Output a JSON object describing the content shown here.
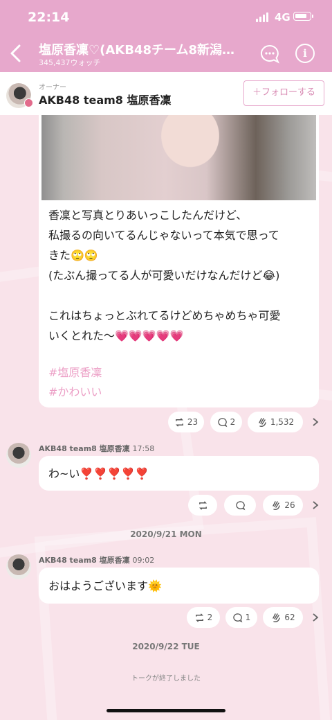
{
  "status_bar": {
    "time": "22:14",
    "network": "4G"
  },
  "header": {
    "title": "塩原香凜♡(AKB48チーム8新潟…",
    "watch_count": "345,437ウォッチ"
  },
  "owner": {
    "label": "オーナー",
    "name": "AKB48 team8 塩原香凜",
    "follow_button": "＋フォローする"
  },
  "post": {
    "line1": "香凜と写真とりあいっこしたんだけど、",
    "line2": "私撮るの向いてるんじゃないって本気で思って",
    "line3": "きた🙄🙄",
    "line4": "(たぶん撮ってる人が可愛いだけなんだけど😂)",
    "line5": "これはちょっとぶれてるけどめちゃめちゃ可愛",
    "line6": "いくとれた〜💗💗💗💗💗",
    "hashtag1": "#塩原香凜",
    "hashtag2": "#かわいい",
    "reactions": {
      "retweet": "23",
      "comment": "2",
      "clap": "1,532"
    }
  },
  "msg2": {
    "sender": "AKB48 team8 塩原香凜",
    "time": "17:58",
    "text": "わ~い❣️❣️❣️❣️❣️",
    "reactions": {
      "clap": "26"
    }
  },
  "date1": "2020/9/21 MON",
  "msg3": {
    "sender": "AKB48 team8 塩原香凜",
    "time": "09:02",
    "text": "おはようございます🌞",
    "reactions": {
      "retweet": "2",
      "comment": "1",
      "clap": "62"
    }
  },
  "date2": "2020/9/22 TUE",
  "end_note": "トークが終了しました",
  "colors": {
    "header_pink": "#e7a8cc",
    "background": "#f9e3ea",
    "hashtag": "#ec9fc6"
  }
}
